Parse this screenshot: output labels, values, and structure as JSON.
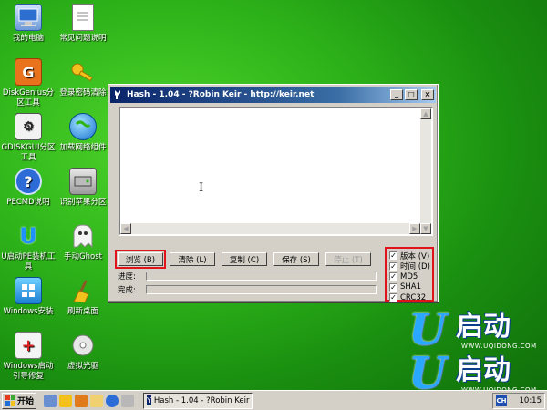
{
  "desktop": {
    "icons": [
      {
        "label": "我的电脑",
        "icon": "my-computer-icon"
      },
      {
        "label": "常见问题说明",
        "icon": "document-icon"
      },
      {
        "label": "DiskGenius分区工具",
        "icon": "diskgenius-icon"
      },
      {
        "label": "登录密码清除",
        "icon": "key-icon"
      },
      {
        "label": "GDISKGUI分区工具",
        "icon": "gdisk-icon"
      },
      {
        "label": "加载网络组件",
        "icon": "network-globe-icon"
      },
      {
        "label": "PECMD说明",
        "icon": "help-icon"
      },
      {
        "label": "识别苹果分区",
        "icon": "drive-icon"
      },
      {
        "label": "U启动PE装机工具",
        "icon": "u-installer-icon"
      },
      {
        "label": "手动Ghost",
        "icon": "ghost-icon"
      },
      {
        "label": "Windows安装",
        "icon": "windows-setup-icon"
      },
      {
        "label": "刷新桌面",
        "icon": "broom-icon"
      },
      {
        "label": "Windows启动引导修复",
        "icon": "medkit-icon"
      },
      {
        "label": "虚拟光驱",
        "icon": "cd-icon"
      }
    ],
    "watermark": {
      "letter": "U",
      "text": "启动",
      "url": "WWW.UQIDONG.COM"
    }
  },
  "window": {
    "title": "Hash - 1.04 - ?Robin Keir - http://keir.net",
    "buttons": {
      "browse": "浏览 (B)",
      "clear": "清除 (L)",
      "copy": "复制 (C)",
      "save": "保存 (S)",
      "stop": "停止 (T)"
    },
    "progress_label": "进度:",
    "complete_label": "完成:",
    "progress_value": 0,
    "complete_value": 0,
    "checkboxes": [
      {
        "label": "版本 (V)",
        "checked": true
      },
      {
        "label": "时间 (D)",
        "checked": true
      },
      {
        "label": "MD5",
        "checked": true
      },
      {
        "label": "SHA1",
        "checked": true
      },
      {
        "label": "CRC32",
        "checked": true
      }
    ]
  },
  "taskbar": {
    "start": "开始",
    "task_item": "Hash - 1.04 - ?Robin Keir ...",
    "lang": "CH",
    "clock": "10:15"
  },
  "colors": {
    "highlight_red": "#e0121a",
    "titlebar_start": "#0a246a",
    "desktop_green": "#2fb51a"
  }
}
